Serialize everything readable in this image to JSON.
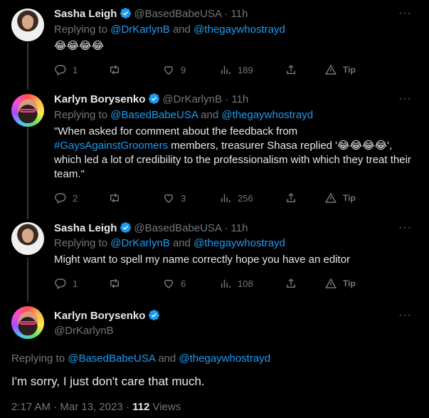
{
  "tweets": [
    {
      "name": "Sasha Leigh",
      "handle": "@BasedBabeUSA",
      "time": "11h",
      "reply_prefix": "Replying to ",
      "reply_to_1": "@DrKarlynB",
      "reply_and": " and ",
      "reply_to_2": "@thegaywhostrayd",
      "text": "😂😂😂😂",
      "replies": "1",
      "retweets": "",
      "likes": "9",
      "views": "189",
      "tip": "Tip"
    },
    {
      "name": "Karlyn Borysenko",
      "handle": "@DrKarlynB",
      "time": "11h",
      "reply_prefix": "Replying to ",
      "reply_to_1": "@BasedBabeUSA",
      "reply_and": " and ",
      "reply_to_2": "@thegaywhostrayd",
      "text_a": "\"When asked for comment about the feedback from ",
      "text_hashtag": "#GaysAgainstGroomers",
      "text_b": " members, treasurer Shasa replied '😂😂😂😂', which led a lot of credibility to the professionalism with which they treat their team.\"",
      "replies": "2",
      "retweets": "",
      "likes": "3",
      "views": "256",
      "tip": "Tip"
    },
    {
      "name": "Sasha Leigh",
      "handle": "@BasedBabeUSA",
      "time": "11h",
      "reply_prefix": "Replying to ",
      "reply_to_1": "@DrKarlynB",
      "reply_and": " and ",
      "reply_to_2": "@thegaywhostrayd",
      "text": "Might want to spell my name correctly hope you have an editor",
      "replies": "1",
      "retweets": "",
      "likes": "6",
      "views": "108",
      "tip": "Tip"
    }
  ],
  "main": {
    "name": "Karlyn Borysenko",
    "handle": "@DrKarlynB",
    "reply_prefix": "Replying to ",
    "reply_to_1": "@BasedBabeUSA",
    "reply_and": " and ",
    "reply_to_2": "@thegaywhostrayd",
    "text": "I'm sorry, I just don't care that much.",
    "timestamp": "2:17 AM · Mar 13, 2023 · ",
    "views_count": "112",
    "views_label": " Views"
  },
  "separator": " · ",
  "more_glyph": "···",
  "colors": {
    "accent": "#1d9bf0",
    "muted": "#71767b",
    "text": "#e7e9ea",
    "background": "#000000"
  },
  "icons": [
    "verified-badge-icon",
    "reply-icon",
    "retweet-icon",
    "like-icon",
    "views-icon",
    "share-icon",
    "tip-icon",
    "more-icon"
  ]
}
